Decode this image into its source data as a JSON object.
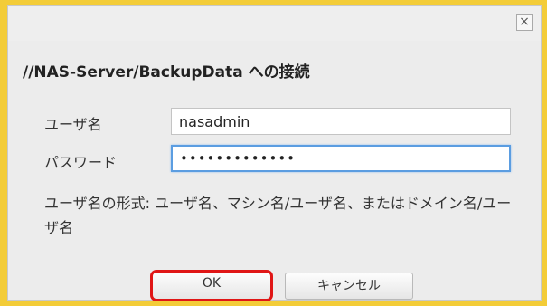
{
  "dialog": {
    "close_glyph": "×",
    "heading": "//NAS-Server/BackupData への接続",
    "username_label": "ユーザ名",
    "username_value": "nasadmin",
    "password_label": "パスワード",
    "password_value": "•••••••••••••",
    "hint": "ユーザ名の形式: ユーザ名、マシン名/ユーザ名、またはドメイン名/ユーザ名",
    "ok_label": "OK",
    "cancel_label": "キャンセル"
  },
  "colors": {
    "background": "#f3cc38",
    "focus_border": "#5b9de1",
    "highlight": "#e01616"
  }
}
